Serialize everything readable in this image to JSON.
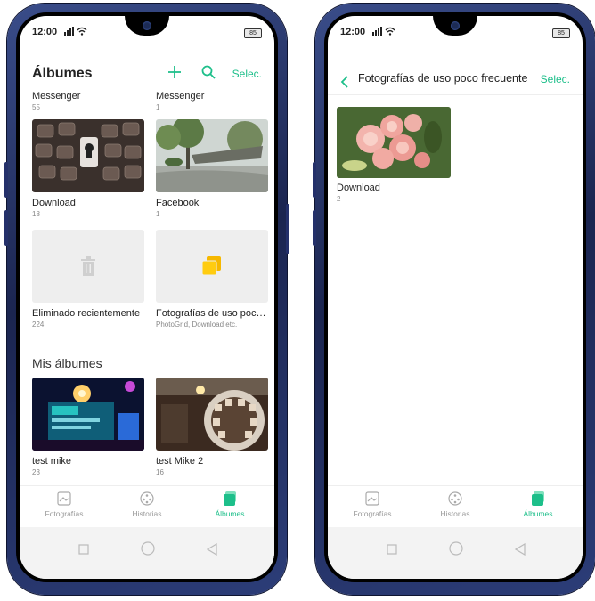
{
  "status": {
    "time": "12:00",
    "signal": "®ıl",
    "wifi": "◔",
    "battery": "85"
  },
  "left": {
    "title": "Álbumes",
    "select": "Selec.",
    "albums_top": [
      {
        "name": "Messenger",
        "count": "55"
      },
      {
        "name": "Messenger",
        "count": "1"
      }
    ],
    "albums": [
      {
        "name": "Download",
        "count": "18"
      },
      {
        "name": "Facebook",
        "count": "1"
      },
      {
        "name": "Eliminado recientemente",
        "count": "224"
      },
      {
        "name": "Fotografías de uso poco fre...",
        "count": "PhotoGrid, Download etc."
      }
    ],
    "section": "Mis álbumes",
    "my_albums": [
      {
        "name": "test mike",
        "count": "23"
      },
      {
        "name": "test Mike 2",
        "count": "16"
      }
    ]
  },
  "right": {
    "title": "Fotografías de uso poco frecuente",
    "select": "Selec.",
    "albums": [
      {
        "name": "Download",
        "count": "2"
      }
    ]
  },
  "nav": {
    "photos": "Fotografías",
    "stories": "Historias",
    "albums": "Álbumes"
  },
  "colors": {
    "accent": "#1dbf8a",
    "frame": "#1b2550"
  },
  "icons": {
    "add": "plus-icon",
    "search": "search-icon",
    "back": "chevron-left-icon",
    "trash": "trash-icon",
    "folder": "folder-icon"
  }
}
